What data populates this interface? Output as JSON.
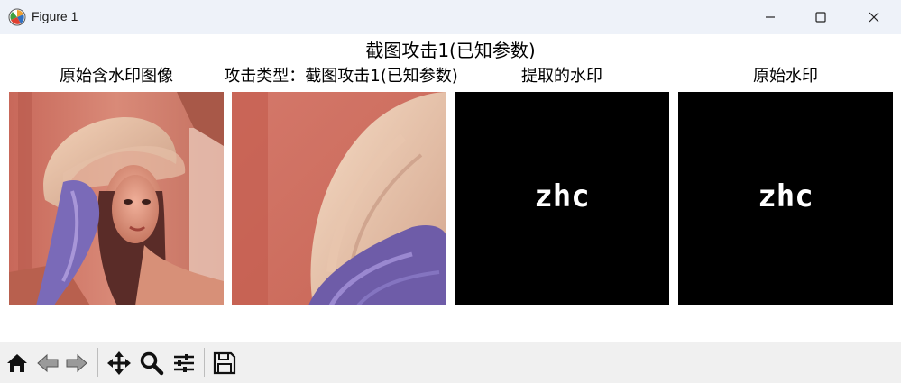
{
  "window": {
    "title": "Figure 1"
  },
  "figure": {
    "suptitle": "截图攻击1(已知参数)",
    "panels": [
      {
        "title": "原始含水印图像"
      },
      {
        "title": "攻击类型：截图攻击1(已知参数)"
      },
      {
        "title": "提取的水印",
        "watermark_text": "zhc"
      },
      {
        "title": "原始水印",
        "watermark_text": "zhc"
      }
    ]
  },
  "toolbar": {
    "tools": [
      "home-icon",
      "back-arrow-icon",
      "forward-arrow-icon",
      "pan-move-icon",
      "zoom-magnifier-icon",
      "configure-subplots-icon",
      "save-floppy-icon"
    ]
  },
  "colors": {
    "titlebar_bg": "#eef2f9",
    "toolbar_bg": "#f0f0f0",
    "watermark_bg": "#000000"
  }
}
